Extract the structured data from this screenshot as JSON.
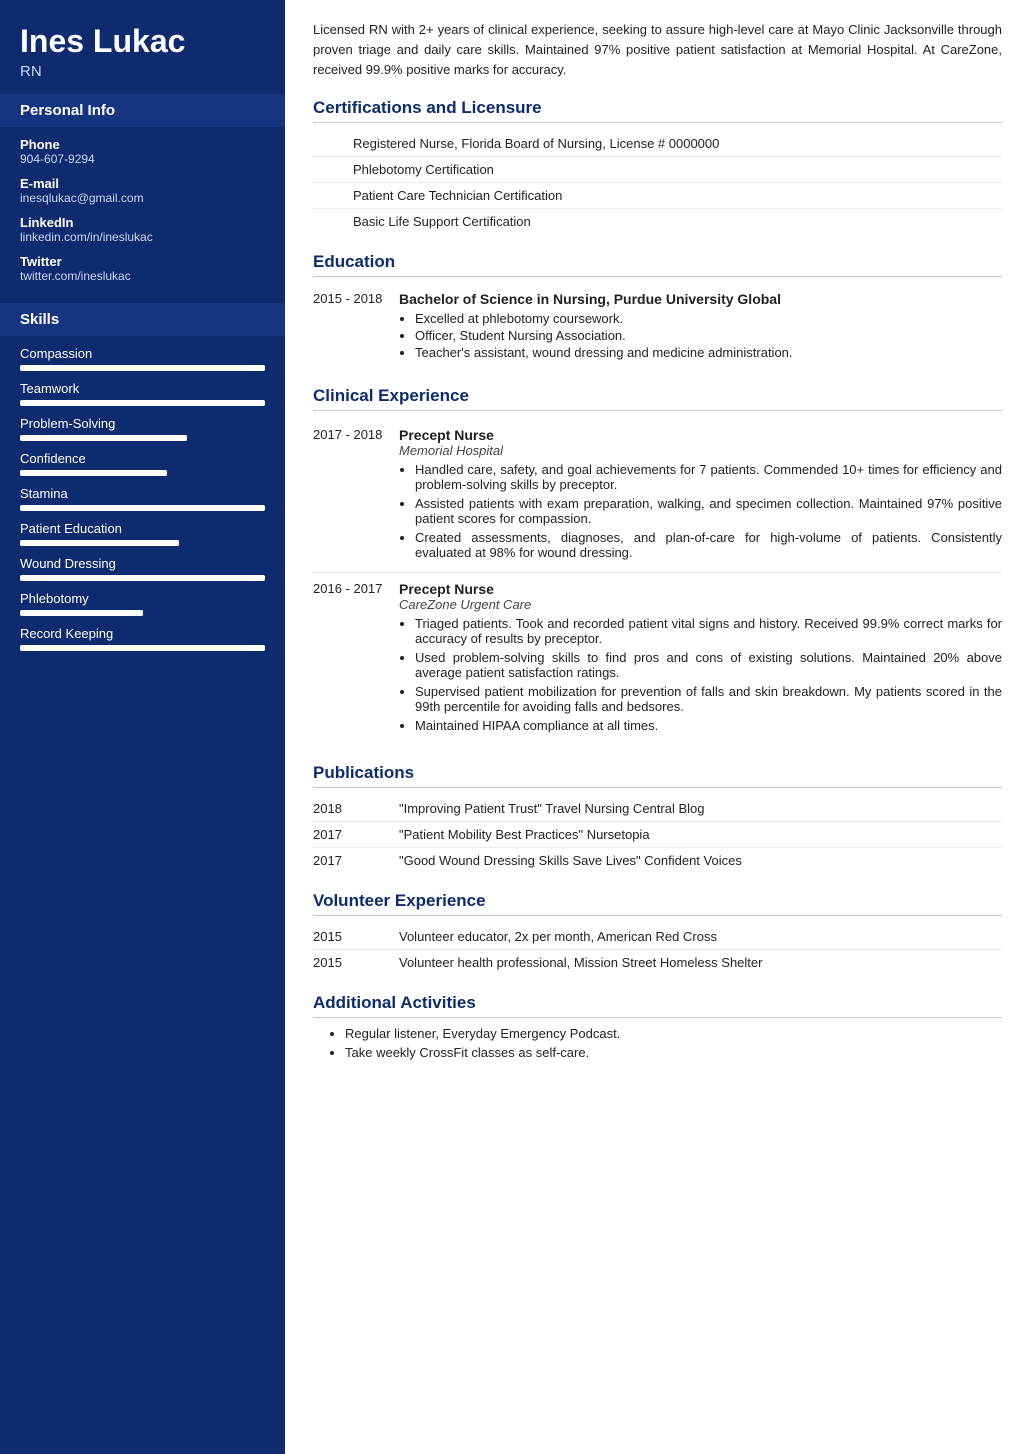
{
  "sidebar": {
    "name": "Ines Lukac",
    "title": "RN",
    "personal_info_header": "Personal Info",
    "contacts": [
      {
        "label": "Phone",
        "value": "904-607-9294"
      },
      {
        "label": "E-mail",
        "value": "inesqlukac@gmail.com"
      },
      {
        "label": "LinkedIn",
        "value": "linkedin.com/in/ineslukac"
      },
      {
        "label": "Twitter",
        "value": "twitter.com/ineslukac"
      }
    ],
    "skills_header": "Skills",
    "skills": [
      {
        "name": "Compassion",
        "fill_pct": 100,
        "dark_pct": 0
      },
      {
        "name": "Teamwork",
        "fill_pct": 100,
        "dark_pct": 0
      },
      {
        "name": "Problem-Solving",
        "fill_pct": 68,
        "dark_pct": 32
      },
      {
        "name": "Confidence",
        "fill_pct": 60,
        "dark_pct": 40
      },
      {
        "name": "Stamina",
        "fill_pct": 100,
        "dark_pct": 0
      },
      {
        "name": "Patient Education",
        "fill_pct": 65,
        "dark_pct": 35
      },
      {
        "name": "Wound Dressing",
        "fill_pct": 100,
        "dark_pct": 0
      },
      {
        "name": "Phlebotomy",
        "fill_pct": 50,
        "dark_pct": 50
      },
      {
        "name": "Record Keeping",
        "fill_pct": 100,
        "dark_pct": 0
      }
    ]
  },
  "main": {
    "summary": "Licensed RN with 2+ years of clinical experience, seeking to assure high-level care at Mayo Clinic Jacksonville through proven triage and daily care skills. Maintained 97% positive patient satisfaction at Memorial Hospital. At CareZone, received 99.9% positive marks for accuracy.",
    "sections": {
      "certifications": {
        "header": "Certifications and Licensure",
        "items": [
          "Registered Nurse, Florida Board of Nursing, License # 0000000",
          "Phlebotomy Certification",
          "Patient Care Technician Certification",
          "Basic Life Support Certification"
        ]
      },
      "education": {
        "header": "Education",
        "items": [
          {
            "years": "2015 - 2018",
            "title": "Bachelor of Science in Nursing, Purdue University Global",
            "bullets": [
              "Excelled at phlebotomy coursework.",
              "Officer, Student Nursing Association.",
              "Teacher's assistant, wound dressing and medicine administration."
            ]
          }
        ]
      },
      "clinical_experience": {
        "header": "Clinical Experience",
        "items": [
          {
            "years": "2017 - 2018",
            "job_title": "Precept Nurse",
            "company": "Memorial Hospital",
            "bullets": [
              "Handled care, safety, and goal achievements for 7 patients. Commended 10+ times for efficiency and problem-solving skills by preceptor.",
              "Assisted patients with exam preparation, walking, and specimen collection. Maintained 97% positive patient scores for compassion.",
              "Created assessments, diagnoses, and plan-of-care for high-volume of patients. Consistently evaluated at 98% for wound dressing."
            ]
          },
          {
            "years": "2016 - 2017",
            "job_title": "Precept Nurse",
            "company": "CareZone Urgent Care",
            "bullets": [
              "Triaged patients. Took and recorded patient vital signs and history. Received 99.9% correct marks for accuracy of results by preceptor.",
              "Used problem-solving skills to find pros and cons of existing solutions. Maintained 20% above average patient satisfaction ratings.",
              "Supervised patient mobilization for prevention of falls and skin breakdown. My patients scored in the 99th percentile for avoiding falls and bedsores.",
              "Maintained HIPAA compliance at all times."
            ]
          }
        ]
      },
      "publications": {
        "header": "Publications",
        "items": [
          {
            "year": "2018",
            "text": "\"Improving Patient Trust\" Travel Nursing Central Blog"
          },
          {
            "year": "2017",
            "text": "\"Patient Mobility Best Practices\" Nursetopia"
          },
          {
            "year": "2017",
            "text": "\"Good Wound Dressing Skills Save Lives\" Confident Voices"
          }
        ]
      },
      "volunteer": {
        "header": "Volunteer Experience",
        "items": [
          {
            "year": "2015",
            "text": "Volunteer educator, 2x per month, American Red Cross"
          },
          {
            "year": "2015",
            "text": "Volunteer health professional, Mission Street Homeless Shelter"
          }
        ]
      },
      "additional": {
        "header": "Additional Activities",
        "bullets": [
          "Regular listener, Everyday Emergency Podcast.",
          "Take weekly CrossFit classes as self-care."
        ]
      }
    }
  }
}
